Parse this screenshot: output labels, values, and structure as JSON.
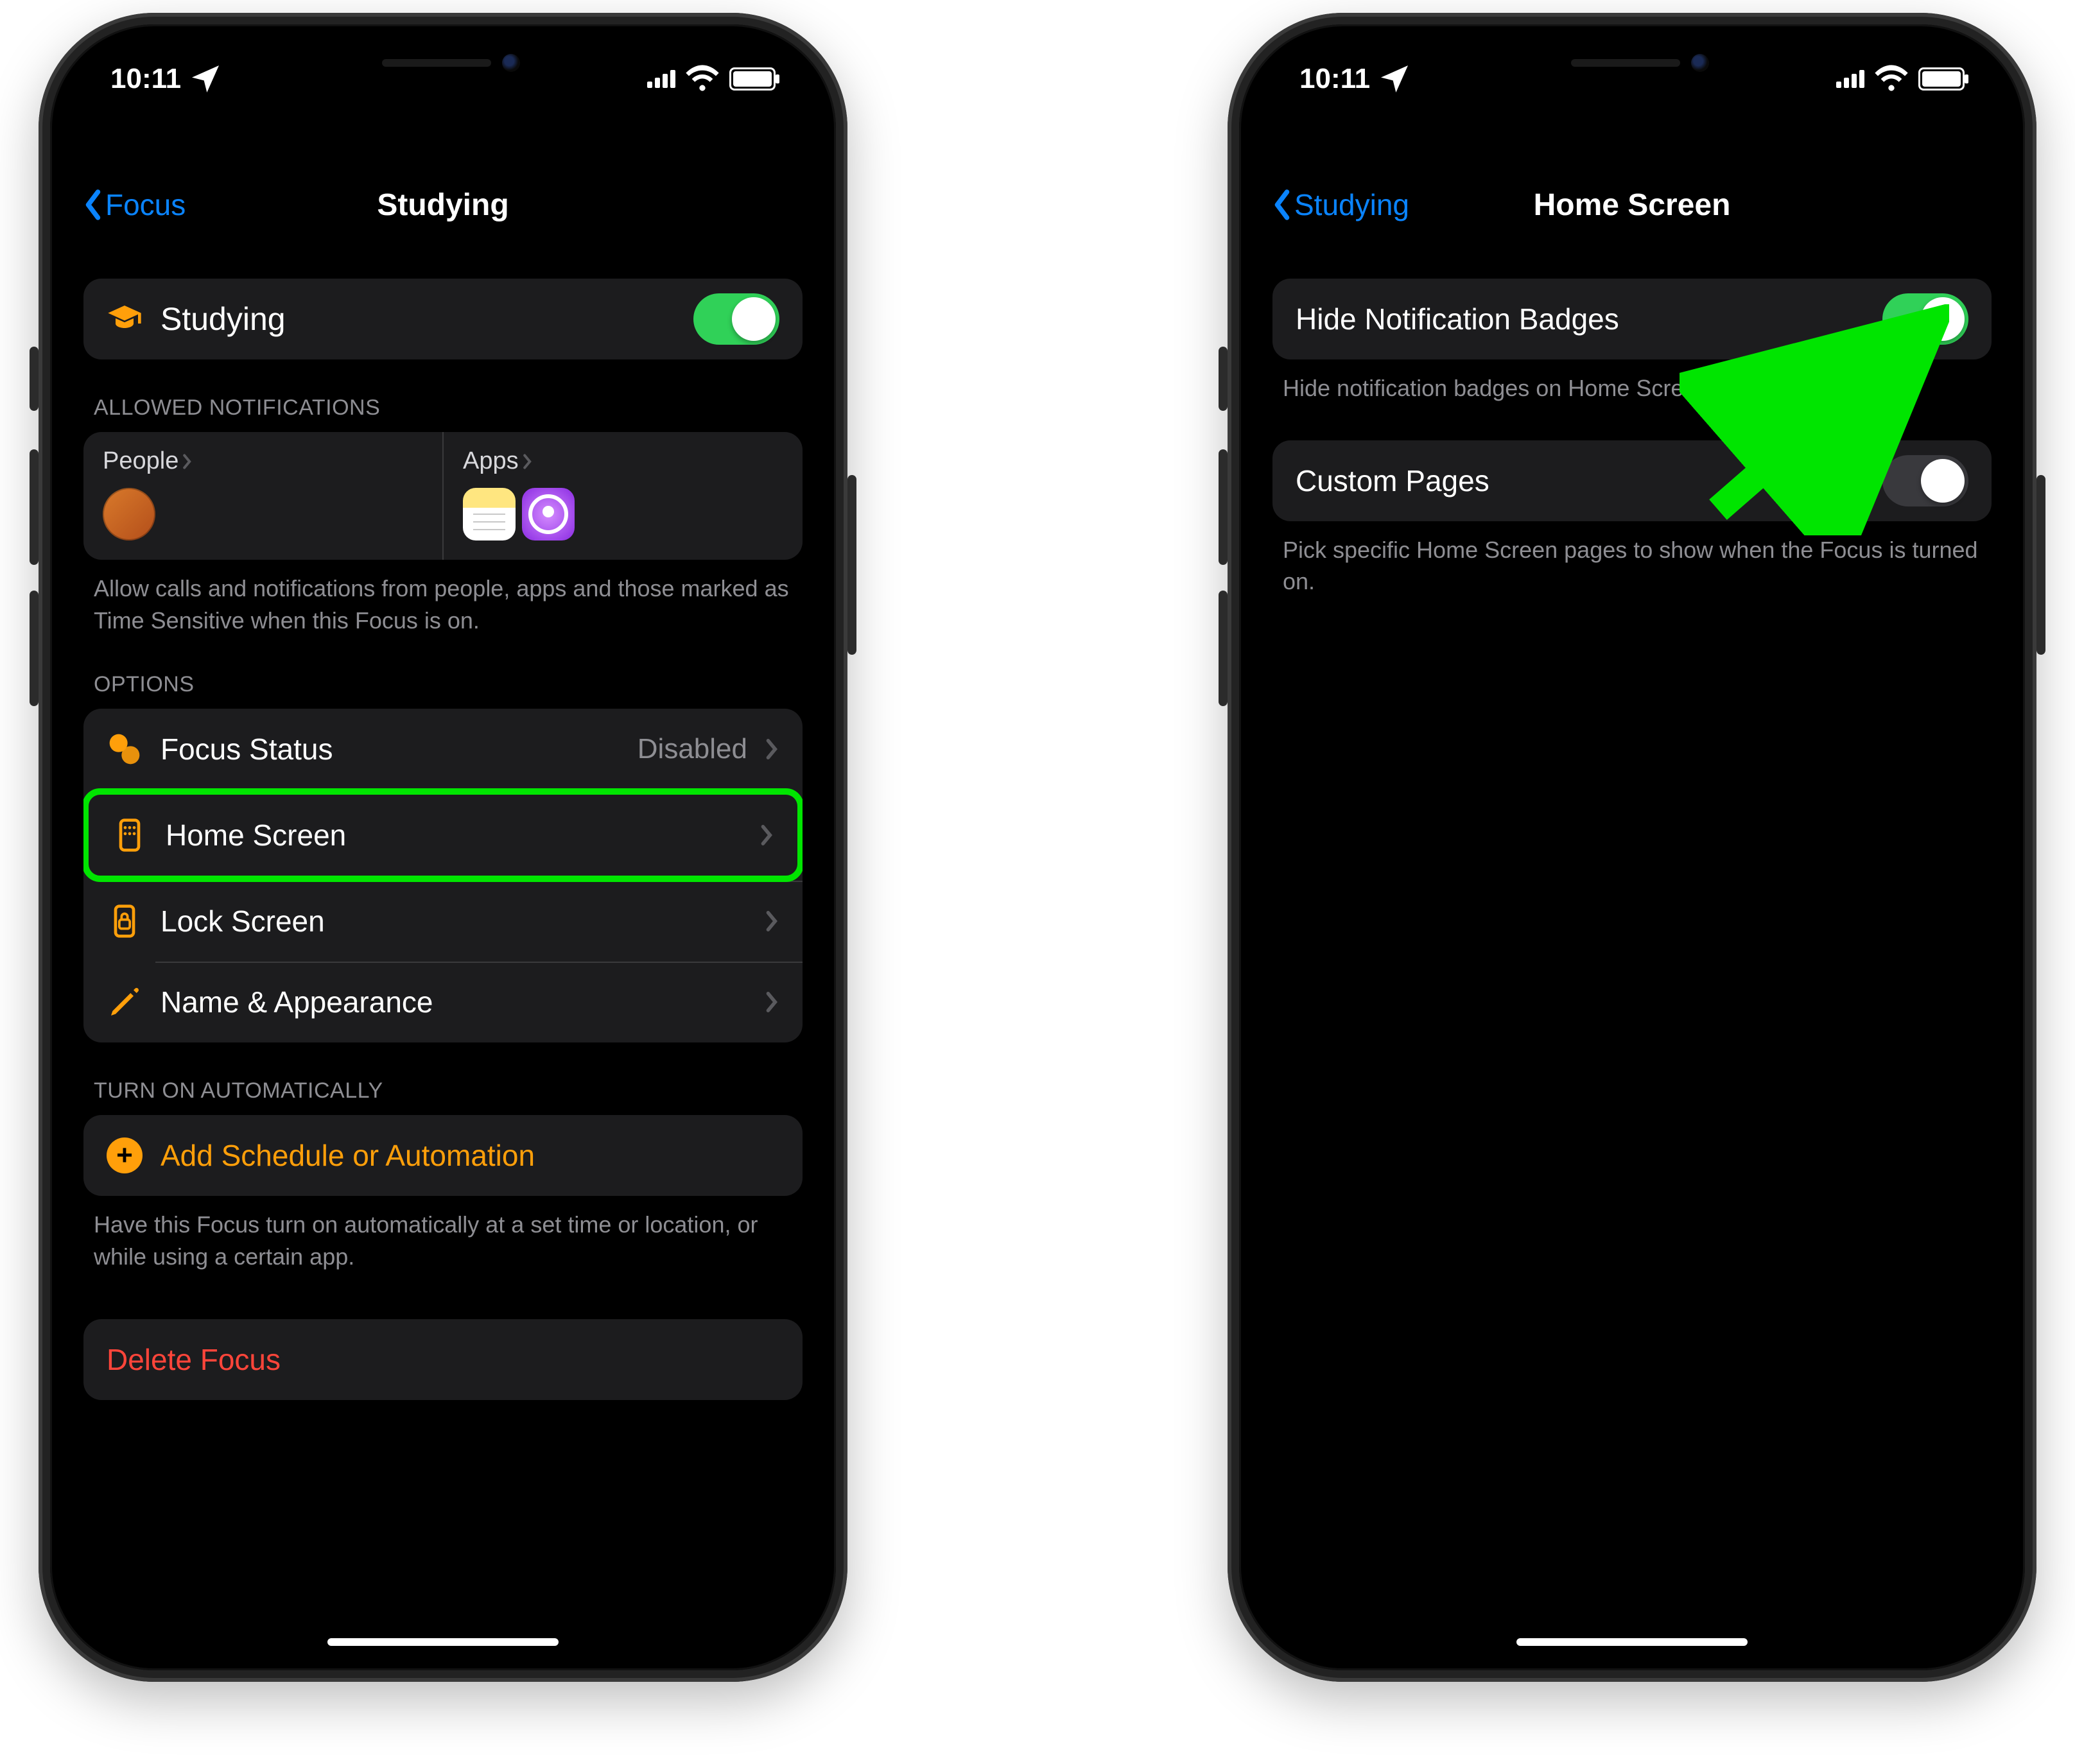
{
  "status": {
    "time": "10:11"
  },
  "phone1": {
    "nav": {
      "back": "Focus",
      "title": "Studying"
    },
    "focus": {
      "name": "Studying",
      "enabled": true
    },
    "allowed": {
      "header": "ALLOWED NOTIFICATIONS",
      "people_label": "People",
      "apps_label": "Apps",
      "footer": "Allow calls and notifications from people, apps and those marked as Time Sensitive when this Focus is on."
    },
    "options": {
      "header": "OPTIONS",
      "focus_status": {
        "label": "Focus Status",
        "detail": "Disabled"
      },
      "home_screen": {
        "label": "Home Screen"
      },
      "lock_screen": {
        "label": "Lock Screen"
      },
      "name_appearance": {
        "label": "Name & Appearance"
      }
    },
    "auto": {
      "header": "TURN ON AUTOMATICALLY",
      "add": "Add Schedule or Automation",
      "footer": "Have this Focus turn on automatically at a set time or location, or while using a certain app."
    },
    "delete": "Delete Focus"
  },
  "phone2": {
    "nav": {
      "back": "Studying",
      "title": "Home Screen"
    },
    "hide_badges": {
      "label": "Hide Notification Badges",
      "on": true,
      "footer": "Hide notification badges on Home Screen apps."
    },
    "custom_pages": {
      "label": "Custom Pages",
      "on": false,
      "footer": "Pick specific Home Screen pages to show when the Focus is turned on."
    }
  }
}
